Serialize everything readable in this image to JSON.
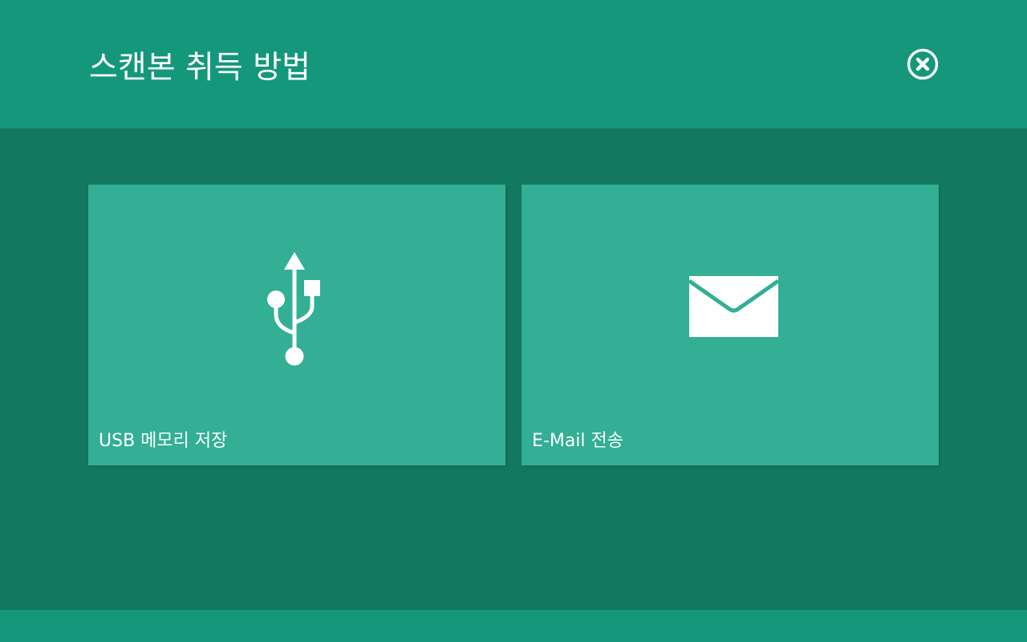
{
  "header": {
    "title": "스캔본 취득 방법",
    "close_icon": "close-circle-icon"
  },
  "options": [
    {
      "label": "USB 메모리 저장",
      "icon": "usb-icon"
    },
    {
      "label": "E-Mail 전송",
      "icon": "envelope-icon"
    }
  ],
  "colors": {
    "header_bg": "#14977b",
    "main_bg": "#12785f",
    "tile_bg": "#32af95",
    "footer_bg": "#14977b",
    "text": "#ffffff"
  }
}
